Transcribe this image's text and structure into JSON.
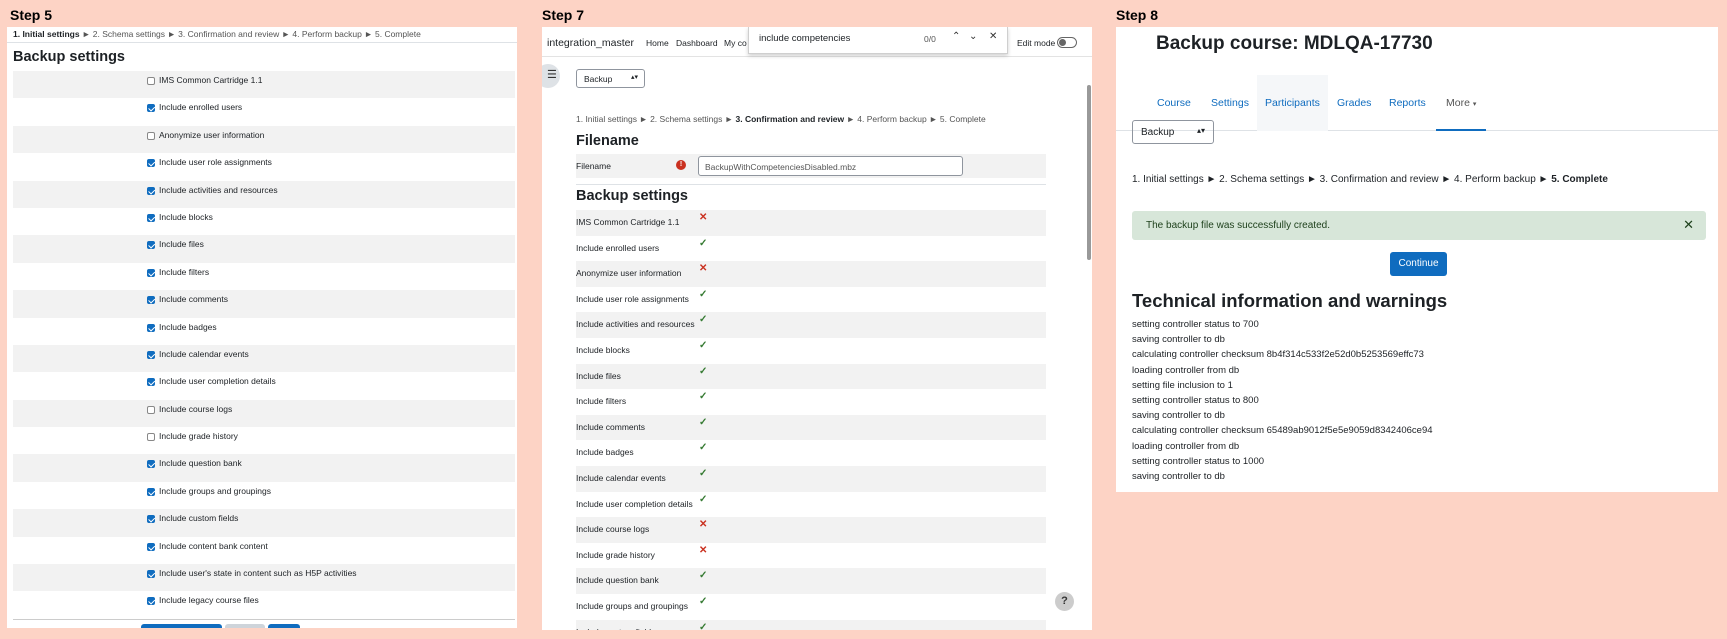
{
  "steps": {
    "step5": "Step 5",
    "step7": "Step 7",
    "step8": "Step 8"
  },
  "panel1": {
    "crumbs": {
      "current": "1. Initial settings",
      "rest": " ► 2. Schema settings ► 3. Confirmation and review ► 4. Perform backup ► 5. Complete"
    },
    "heading": "Backup settings",
    "settings": [
      {
        "label": "IMS Common Cartridge 1.1",
        "checked": false
      },
      {
        "label": "Include enrolled users",
        "checked": true
      },
      {
        "label": "Anonymize user information",
        "checked": false
      },
      {
        "label": "Include user role assignments",
        "checked": true
      },
      {
        "label": "Include activities and resources",
        "checked": true
      },
      {
        "label": "Include blocks",
        "checked": true
      },
      {
        "label": "Include files",
        "checked": true
      },
      {
        "label": "Include filters",
        "checked": true
      },
      {
        "label": "Include comments",
        "checked": true
      },
      {
        "label": "Include badges",
        "checked": true
      },
      {
        "label": "Include calendar events",
        "checked": true
      },
      {
        "label": "Include user completion details",
        "checked": true
      },
      {
        "label": "Include course logs",
        "checked": false
      },
      {
        "label": "Include grade history",
        "checked": false
      },
      {
        "label": "Include question bank",
        "checked": true
      },
      {
        "label": "Include groups and groupings",
        "checked": true
      },
      {
        "label": "Include custom fields",
        "checked": true
      },
      {
        "label": "Include content bank content",
        "checked": true
      },
      {
        "label": "Include user's state in content such as H5P activities",
        "checked": true
      },
      {
        "label": "Include legacy course files",
        "checked": true
      }
    ]
  },
  "panel2": {
    "site_name": "integration_master",
    "nav": [
      "Home",
      "Dashboard",
      "My co"
    ],
    "find": {
      "query": "include competencies",
      "count": "0/0",
      "up_icon": "⌃",
      "down_icon": "⌄",
      "close_icon": "✕"
    },
    "edit_mode": "Edit mode",
    "drawer_icon": "☰",
    "select_value": "Backup",
    "crumbs": {
      "done": "1. Initial settings ► 2. Schema settings ► ",
      "current": "3. Confirmation and review",
      "rest": " ► 4. Perform backup ► 5. Complete"
    },
    "filename_heading": "Filename",
    "filename_label": "Filename",
    "filename_value": "BackupWithCompetenciesDisabled.mbz",
    "settings_heading": "Backup settings",
    "settings": [
      {
        "label": "IMS Common Cartridge 1.1",
        "value": false
      },
      {
        "label": "Include enrolled users",
        "value": true
      },
      {
        "label": "Anonymize user information",
        "value": false
      },
      {
        "label": "Include user role assignments",
        "value": true
      },
      {
        "label": "Include activities and resources",
        "value": true
      },
      {
        "label": "Include blocks",
        "value": true
      },
      {
        "label": "Include files",
        "value": true
      },
      {
        "label": "Include filters",
        "value": true
      },
      {
        "label": "Include comments",
        "value": true
      },
      {
        "label": "Include badges",
        "value": true
      },
      {
        "label": "Include calendar events",
        "value": true
      },
      {
        "label": "Include user completion details",
        "value": true
      },
      {
        "label": "Include course logs",
        "value": false
      },
      {
        "label": "Include grade history",
        "value": false
      },
      {
        "label": "Include question bank",
        "value": true
      },
      {
        "label": "Include groups and groupings",
        "value": true
      },
      {
        "label": "Include custom fields",
        "value": true
      }
    ],
    "help": "?"
  },
  "panel3": {
    "title": "Backup course: MDLQA-17730",
    "tabs": [
      "Course",
      "Settings",
      "Participants",
      "Grades",
      "Reports",
      "More"
    ],
    "select_value": "Backup",
    "crumbs": {
      "done": "1. Initial settings ► 2. Schema settings ► 3. Confirmation and review ► 4. Perform backup ► ",
      "current": "5. Complete"
    },
    "alert": "The backup file was successfully created.",
    "continue": "Continue",
    "tech_heading": "Technical information and warnings",
    "log": [
      "setting controller status to 700",
      "saving controller to db",
      "calculating controller checksum 8b4f314c533f2e52d0b5253569effc73",
      "loading controller from db",
      "setting file inclusion to 1",
      "setting controller status to 800",
      "saving controller to db",
      "calculating controller checksum 65489ab9012f5e5e9059d8342406ce94",
      "loading controller from db",
      "setting controller status to 1000",
      "saving controller to db"
    ]
  },
  "colors": {
    "background": "#fdd3c5",
    "primary": "#0f6cbf",
    "success": "#357a32",
    "danger": "#ca3120",
    "alert_bg": "#d7e6d9"
  }
}
